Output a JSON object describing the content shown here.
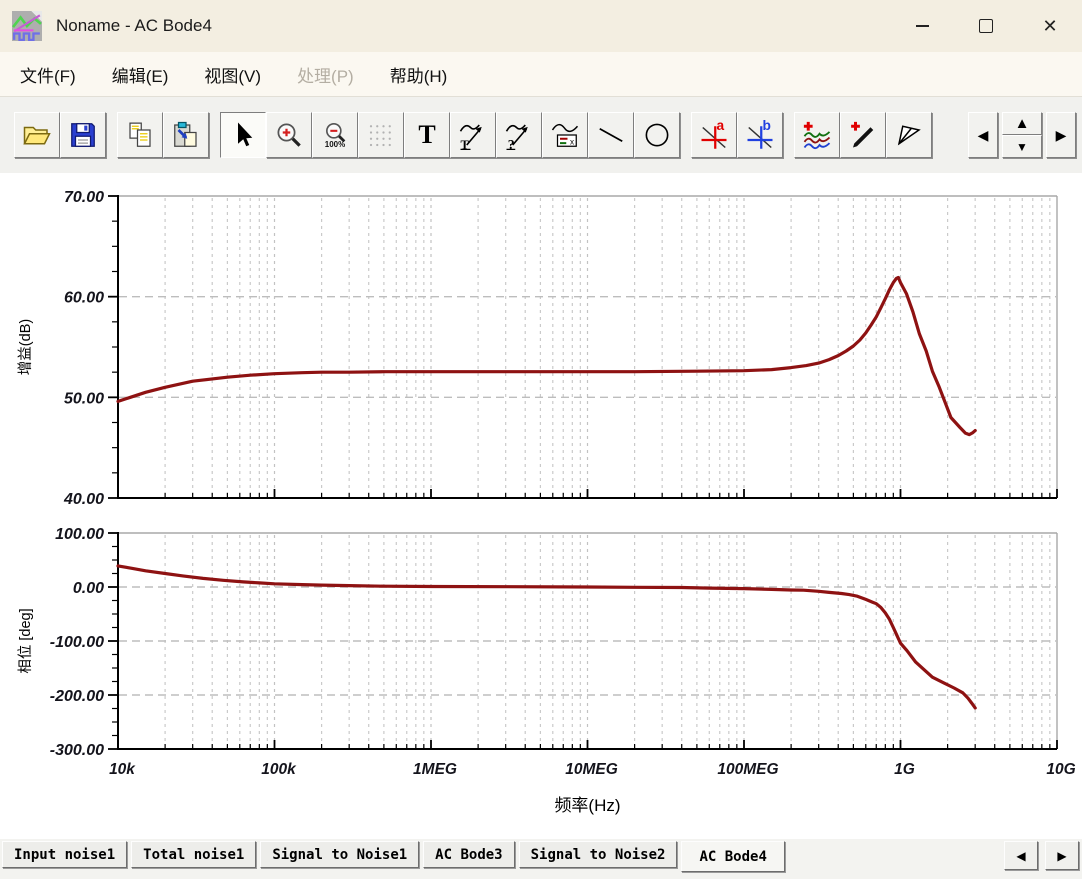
{
  "window": {
    "title": "Noname - AC Bode4"
  },
  "menu": {
    "items": [
      {
        "label": "文件(F)",
        "enabled": true
      },
      {
        "label": "编辑(E)",
        "enabled": true
      },
      {
        "label": "视图(V)",
        "enabled": true
      },
      {
        "label": "处理(P)",
        "enabled": false
      },
      {
        "label": "帮助(H)",
        "enabled": true
      }
    ]
  },
  "toolbar": {
    "buttons": [
      "open",
      "save",
      "copy",
      "paste",
      "select-cursor",
      "zoom-in",
      "zoom-100",
      "grid",
      "text",
      "curve-annotation",
      "curve-query",
      "curve-legend",
      "draw-line",
      "draw-ellipse",
      "cursor-a",
      "cursor-b",
      "add-curves",
      "pick-curve",
      "marker",
      "nav-prev",
      "nav-up",
      "nav-down",
      "nav-next"
    ],
    "active_button": "select-cursor",
    "text_tool_label": "T",
    "zoom100_label": "100%",
    "cursor_a_label": "a",
    "cursor_b_label": "b"
  },
  "icons": {
    "prev": "◀",
    "next": "▶",
    "up": "▲",
    "down": "▼"
  },
  "tabs": {
    "items": [
      {
        "label": "Input noise1",
        "active": false
      },
      {
        "label": "Total noise1",
        "active": false
      },
      {
        "label": "Signal to Noise1",
        "active": false
      },
      {
        "label": "AC Bode3",
        "active": false
      },
      {
        "label": "Signal to Noise2",
        "active": false
      },
      {
        "label": "AC Bode4",
        "active": true
      }
    ]
  },
  "chart_data": [
    {
      "type": "line",
      "x_scale": "log",
      "xlim": [
        10000,
        10000000000
      ],
      "ylim": [
        40,
        70
      ],
      "ylabel": "增益(dB)",
      "grid": true,
      "y_ticks": [
        {
          "value": 70,
          "label": "70.00"
        },
        {
          "value": 60,
          "label": "60.00"
        },
        {
          "value": 50,
          "label": "50.00"
        },
        {
          "value": 40,
          "label": "40.00"
        }
      ],
      "y_minor_step": 2.5,
      "grid_y": [
        60,
        50
      ],
      "series": [
        {
          "name": "gain",
          "color": "#8e1212",
          "points": [
            [
              10000,
              49.6
            ],
            [
              12000,
              50.0
            ],
            [
              15000,
              50.5
            ],
            [
              20000,
              51.0
            ],
            [
              30000,
              51.6
            ],
            [
              50000,
              52.0
            ],
            [
              70000,
              52.2
            ],
            [
              100000,
              52.35
            ],
            [
              150000,
              52.45
            ],
            [
              200000,
              52.5
            ],
            [
              300000,
              52.5
            ],
            [
              500000,
              52.55
            ],
            [
              1000000,
              52.55
            ],
            [
              2000000,
              52.55
            ],
            [
              5000000,
              52.55
            ],
            [
              10000000,
              52.55
            ],
            [
              20000000,
              52.55
            ],
            [
              50000000,
              52.6
            ],
            [
              100000000,
              52.65
            ],
            [
              150000000,
              52.75
            ],
            [
              200000000,
              52.95
            ],
            [
              250000000,
              53.15
            ],
            [
              300000000,
              53.4
            ],
            [
              350000000,
              53.75
            ],
            [
              400000000,
              54.15
            ],
            [
              450000000,
              54.6
            ],
            [
              500000000,
              55.1
            ],
            [
              550000000,
              55.7
            ],
            [
              600000000,
              56.4
            ],
            [
              650000000,
              57.2
            ],
            [
              700000000,
              58.0
            ],
            [
              750000000,
              58.9
            ],
            [
              800000000,
              59.8
            ],
            [
              850000000,
              60.7
            ],
            [
              900000000,
              61.4
            ],
            [
              940000000,
              61.8
            ],
            [
              970000000,
              61.9
            ],
            [
              1000000000,
              61.4
            ],
            [
              1090000000,
              60.3
            ],
            [
              1200000000,
              58.5
            ],
            [
              1320000000,
              56.3
            ],
            [
              1460000000,
              54.6
            ],
            [
              1600000000,
              52.6
            ],
            [
              1770000000,
              51.0
            ],
            [
              1950000000,
              49.3
            ],
            [
              2100000000,
              48.0
            ],
            [
              2400000000,
              47.0
            ],
            [
              2600000000,
              46.45
            ],
            [
              2750000000,
              46.3
            ],
            [
              2900000000,
              46.5
            ],
            [
              3000000000,
              46.7
            ]
          ]
        }
      ]
    },
    {
      "type": "line",
      "x_scale": "log",
      "xlim": [
        10000,
        10000000000
      ],
      "ylim": [
        -300,
        100
      ],
      "ylabel": "相位 [deg]",
      "xlabel": "频率(Hz)",
      "grid": true,
      "x_ticks": [
        {
          "value": 10000,
          "label": "10k"
        },
        {
          "value": 100000,
          "label": "100k"
        },
        {
          "value": 1000000,
          "label": "1MEG"
        },
        {
          "value": 10000000,
          "label": "10MEG"
        },
        {
          "value": 100000000,
          "label": "100MEG"
        },
        {
          "value": 1000000000,
          "label": "1G"
        },
        {
          "value": 10000000000,
          "label": "10G"
        }
      ],
      "y_ticks": [
        {
          "value": 100,
          "label": "100.00"
        },
        {
          "value": 0,
          "label": "0.00"
        },
        {
          "value": -100,
          "label": "-100.00"
        },
        {
          "value": -200,
          "label": "-200.00"
        },
        {
          "value": -300,
          "label": "-300.00"
        }
      ],
      "y_minor_step": 25,
      "grid_y": [
        0,
        -100,
        -200
      ],
      "series": [
        {
          "name": "phase",
          "color": "#8e1212",
          "points": [
            [
              10000,
              39
            ],
            [
              12000,
              35
            ],
            [
              15000,
              30
            ],
            [
              20000,
              25
            ],
            [
              26000,
              20.5
            ],
            [
              35000,
              16
            ],
            [
              47000,
              12.5
            ],
            [
              63000,
              9.5
            ],
            [
              80000,
              7.5
            ],
            [
              100000,
              6
            ],
            [
              150000,
              4.5
            ],
            [
              200000,
              3.5
            ],
            [
              300000,
              2.5
            ],
            [
              500000,
              1.5
            ],
            [
              1000000,
              1
            ],
            [
              3000000,
              0.5
            ],
            [
              10000000,
              0
            ],
            [
              20000000,
              -0.5
            ],
            [
              40000000,
              -1
            ],
            [
              60000000,
              -2
            ],
            [
              100000000,
              -3
            ],
            [
              150000000,
              -4.5
            ],
            [
              200000000,
              -5.5
            ],
            [
              240000000,
              -6
            ],
            [
              300000000,
              -8
            ],
            [
              350000000,
              -10
            ],
            [
              420000000,
              -12
            ],
            [
              470000000,
              -14
            ],
            [
              530000000,
              -17
            ],
            [
              600000000,
              -23
            ],
            [
              660000000,
              -28
            ],
            [
              700000000,
              -31
            ],
            [
              750000000,
              -38
            ],
            [
              800000000,
              -48
            ],
            [
              850000000,
              -60
            ],
            [
              900000000,
              -75
            ],
            [
              950000000,
              -90
            ],
            [
              1000000000,
              -104
            ],
            [
              1100000000,
              -118
            ],
            [
              1250000000,
              -139
            ],
            [
              1400000000,
              -152
            ],
            [
              1600000000,
              -167
            ],
            [
              1900000000,
              -178
            ],
            [
              2200000000,
              -187
            ],
            [
              2500000000,
              -196
            ],
            [
              2700000000,
              -206
            ],
            [
              2850000000,
              -215
            ],
            [
              3000000000,
              -224
            ]
          ]
        }
      ]
    }
  ]
}
